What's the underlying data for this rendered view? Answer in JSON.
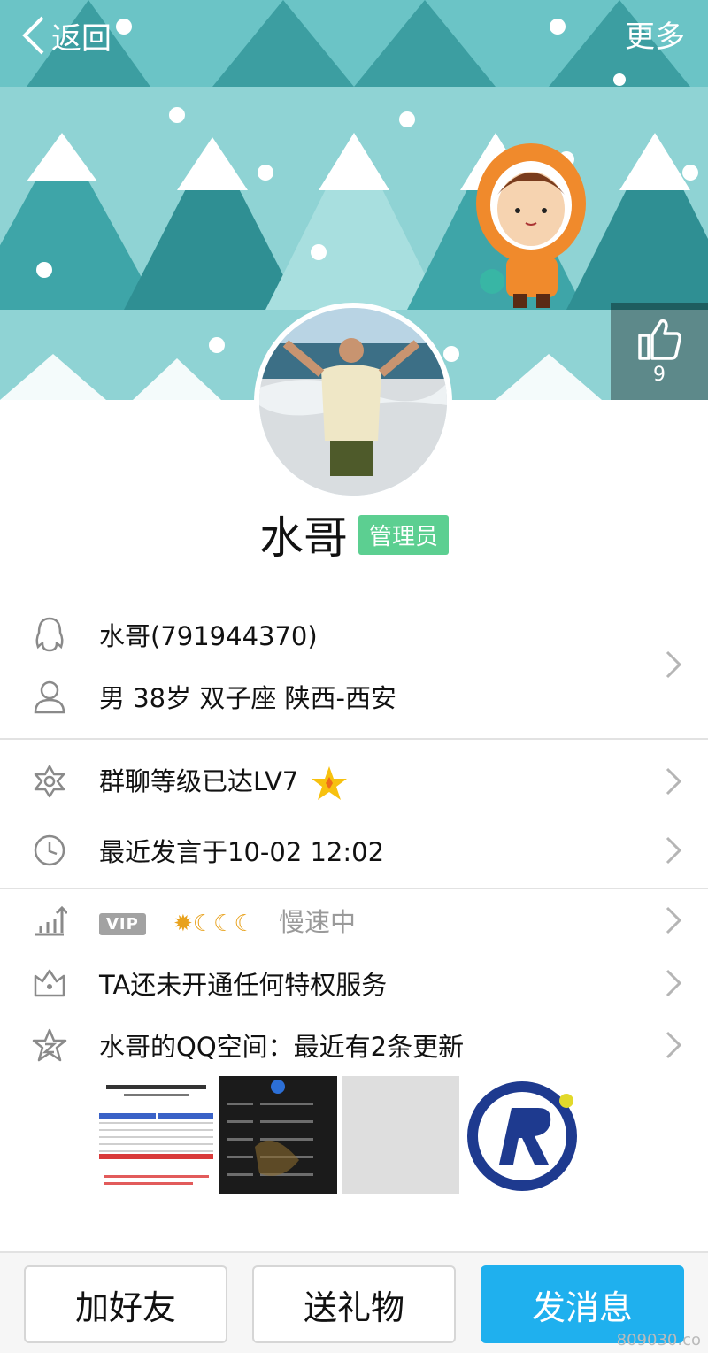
{
  "topbar": {
    "back_label": "返回",
    "more_label": "更多"
  },
  "like": {
    "count": "9"
  },
  "profile": {
    "name": "水哥",
    "role_badge": "管理员"
  },
  "info": {
    "qq": "水哥(791944370)",
    "basic": "男  38岁  双子座  陕西-西安",
    "group_level": "群聊等级已达LV7",
    "last_speak": "最近发言于10-02 12:02",
    "vip_tag": "VIP",
    "speed": "慢速中",
    "privilege": "TA还未开通任何特权服务",
    "qzone": "水哥的QQ空间：最近有2条更新"
  },
  "actions": {
    "add_friend": "加好友",
    "send_gift": "送礼物",
    "send_message": "发消息"
  },
  "watermark": "809030.co",
  "colors": {
    "accent": "#1fb0ee",
    "badge": "#5ccf91",
    "banner": "#8fd3d4"
  },
  "icons": [
    "back-chevron-icon",
    "thumbs-up-icon",
    "qq-penguin-icon",
    "user-icon",
    "level-icon",
    "clock-icon",
    "growth-icon",
    "crown-icon",
    "qzone-star-icon",
    "chevron-right-icon"
  ]
}
